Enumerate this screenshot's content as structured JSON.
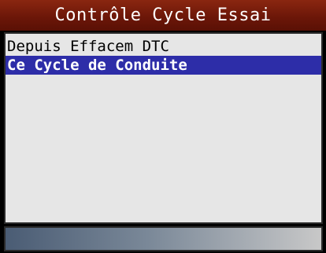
{
  "header": {
    "title": "Contrôle Cycle Essai"
  },
  "menu": {
    "items": [
      {
        "label": "Depuis Effacem DTC",
        "selected": false
      },
      {
        "label": "Ce Cycle de Conduite",
        "selected": true
      }
    ]
  },
  "colors": {
    "title_bar": "#6e1a0c",
    "list_background": "#e6e6e6",
    "selection": "#2d2da8",
    "status_gradient_start": "#4a5c74",
    "status_gradient_end": "#c8c8c8"
  }
}
